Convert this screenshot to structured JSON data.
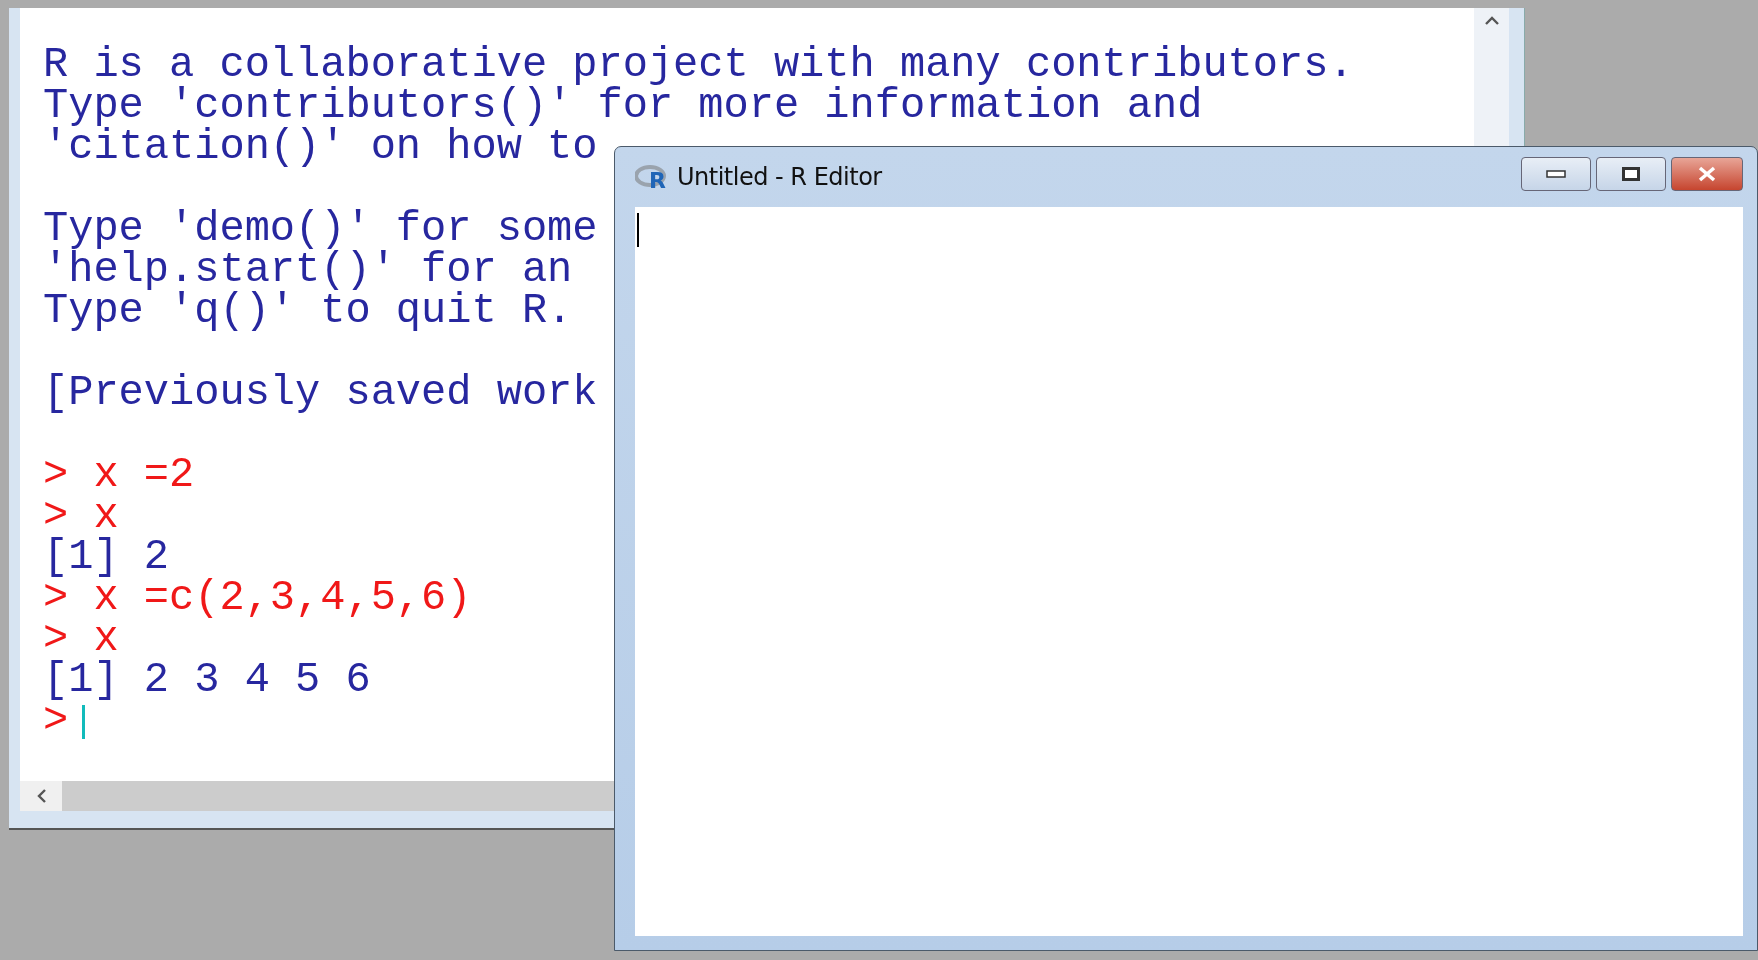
{
  "console": {
    "blocks": [
      {
        "lines": [
          {
            "text": "R is a collaborative project with many contributors.",
            "kind": "output"
          },
          {
            "text": "Type 'contributors()' for more information and",
            "kind": "output"
          },
          {
            "text": "'citation()' on how to",
            "kind": "output"
          }
        ]
      },
      {
        "lines": [
          {
            "text": "Type 'demo()' for some",
            "kind": "output"
          },
          {
            "text": "'help.start()' for an",
            "kind": "output"
          },
          {
            "text": "Type 'q()' to quit R.",
            "kind": "output"
          }
        ]
      },
      {
        "lines": [
          {
            "text": "[Previously saved work",
            "kind": "output"
          }
        ]
      },
      {
        "lines": [
          {
            "text": "> x =2",
            "kind": "input"
          },
          {
            "text": "> x",
            "kind": "input"
          },
          {
            "text": "[1] 2",
            "kind": "output"
          },
          {
            "text": "> x =c(2,3,4,5,6)",
            "kind": "input"
          },
          {
            "text": "> x",
            "kind": "input"
          },
          {
            "text": "[1] 2 3 4 5 6",
            "kind": "output"
          }
        ]
      }
    ],
    "prompt": {
      "text": ">",
      "cursor": true
    }
  },
  "editor": {
    "logo_letter": "R",
    "title": "Untitled - R Editor",
    "cursor": true
  }
}
